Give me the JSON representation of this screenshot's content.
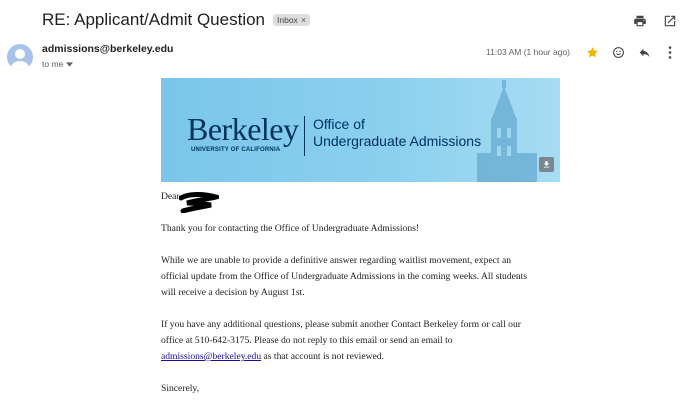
{
  "email": {
    "subject": "RE: Applicant/Admit Question",
    "label_chip": "Inbox",
    "label_chip_close": "×",
    "sender": "admissions@berkeley.edu",
    "recipient": "to me",
    "timestamp": "11:03 AM (1 hour ago)"
  },
  "banner": {
    "logo_word": "Berkeley",
    "logo_sub": "UNIVERSITY OF CALIFORNIA",
    "office_line1": "Office of",
    "office_line2": "Undergraduate Admissions"
  },
  "body": {
    "greeting": "Dear",
    "p1": "Thank you for contacting the Office of Undergraduate Admissions!",
    "p2_l1": "While we are unable to provide a definitive answer regarding waitlist movement, expect an",
    "p2_l2": "official update from the Office of Undergraduate Admissions in the coming weeks. All students",
    "p2_l3": "will receive a decision by August 1st.",
    "p3_l1": "If you have any additional questions, please submit another Contact Berkeley form or call our",
    "p3_l2": "office at 510-642-3175. Please do not reply to this email or send an email to",
    "p3_link": "admissions@berkeley.edu",
    "p3_tail": " as that account is not reviewed.",
    "closing": "Sincerely,"
  },
  "icons": {
    "print": "print-icon",
    "open_new": "open-in-new-window-icon",
    "star": "star-icon",
    "emoji": "emoji-reaction-icon",
    "reply": "reply-icon",
    "more": "more-vertical-icon",
    "download": "download-icon"
  },
  "colors": {
    "star": "#f4b400",
    "berkeley_blue": "#003262",
    "banner_bg": "#87cdee",
    "link": "#1a0dab"
  }
}
